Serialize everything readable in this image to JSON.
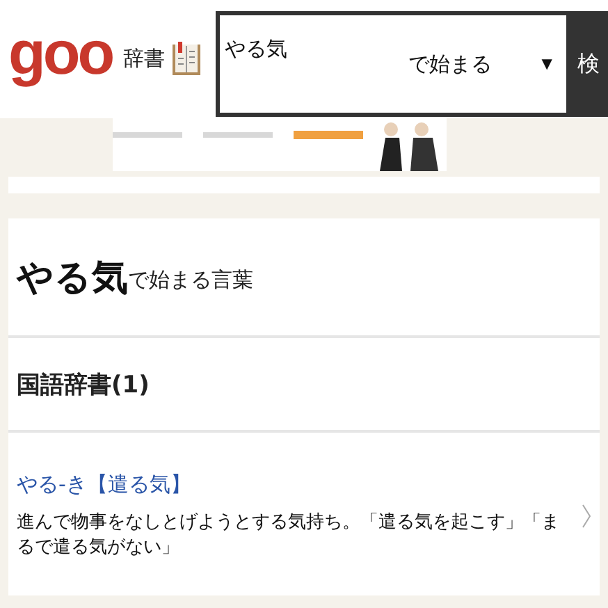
{
  "header": {
    "logo": "goo",
    "site_name": "辞書",
    "search": {
      "value": "やる気",
      "mode": "で始まる",
      "mode_arrow": "▼",
      "button": "検"
    }
  },
  "heading": {
    "query": "やる気",
    "suffix": "で始まる言葉"
  },
  "section": {
    "title": "国語辞書(1)"
  },
  "entries": [
    {
      "headword": "やる-き【遣る気】",
      "definition": "進んで物事をなしとげようとする気持ち。「遣る気を起こす」「まるで遣る気がない」"
    }
  ]
}
